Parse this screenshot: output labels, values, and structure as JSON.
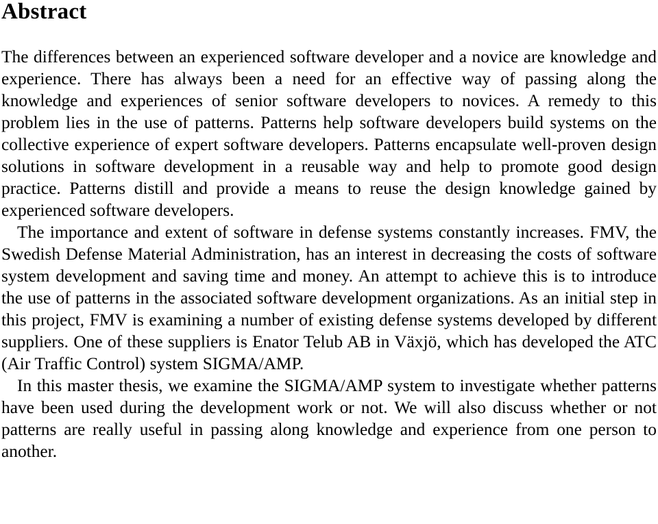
{
  "document": {
    "heading": "Abstract",
    "paragraphs": [
      {
        "id": "para-patterns-intro",
        "indented": false,
        "text": "The differences between an experienced software developer and a novice are knowledge and experience. There has always been a need for an effective way of passing along the knowledge and experiences of senior software developers to novices. A remedy to this problem lies in the use of patterns. Patterns help software developers build systems on the collective experience of expert software developers. Patterns encapsulate well-proven design solutions in software development in a reusable way and help to promote good design practice. Patterns distill and provide a means to reuse the design knowledge gained by experienced software developers."
      },
      {
        "id": "para-fmv-context",
        "indented": true,
        "text": "The importance and extent of software in defense systems constantly increases. FMV, the Swedish Defense Material Administration, has an interest in decreasing the costs of software system development and saving time and money. An attempt to achieve this is to introduce the use of patterns in the associated software development organizations. As an initial step in this project, FMV is examining a number of existing defense systems developed by different suppliers. One of these suppliers is Enator Telub AB in Växjö, which has developed the ATC (Air Traffic Control) system SIGMA/AMP."
      },
      {
        "id": "para-thesis-scope",
        "indented": true,
        "text": "In this master thesis, we examine the SIGMA/AMP system to investigate whether patterns have been used during the development work or not. We will also discuss whether or not patterns are really useful in passing along knowledge and experience from one person to another."
      }
    ]
  }
}
